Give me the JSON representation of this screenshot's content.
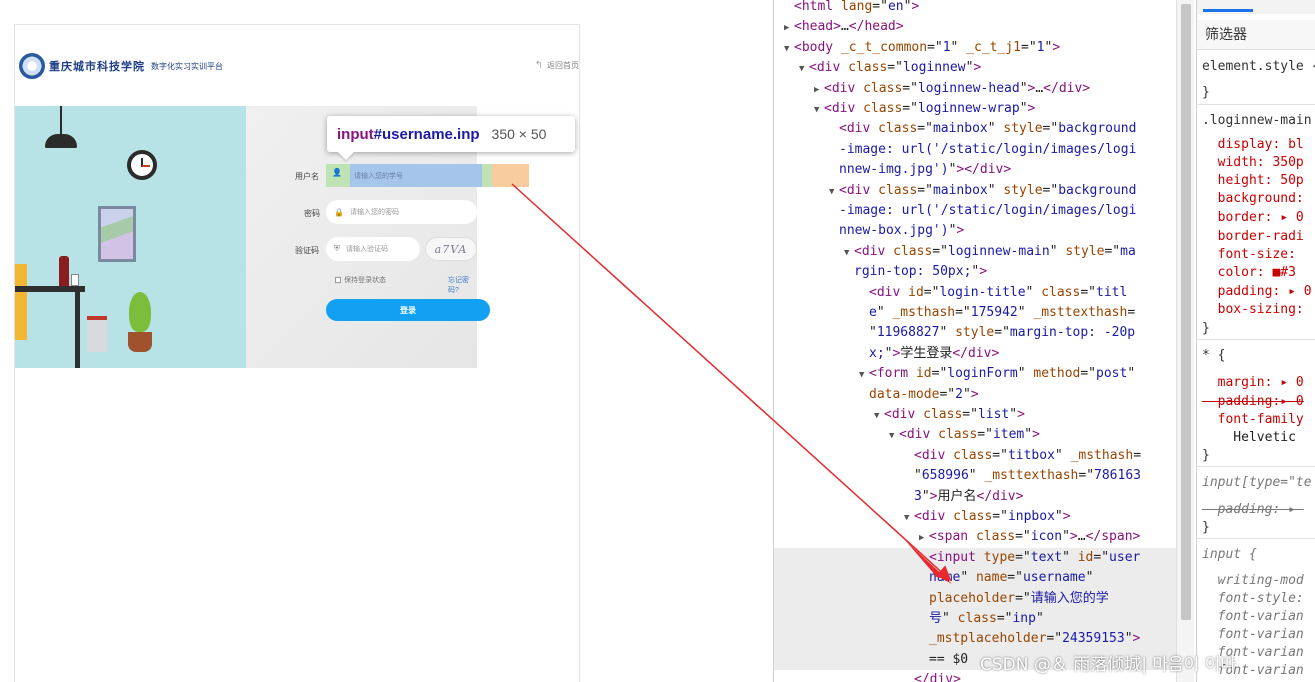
{
  "page": {
    "logo_text": "重庆城市科技学院",
    "platform_name": "数字化实习实训平台",
    "back_link": "返回首页",
    "form": {
      "username_label": "用户名",
      "username_placeholder": "请输入您的学号",
      "password_label": "密码",
      "password_placeholder": "请输入您的密码",
      "captcha_label": "验证码",
      "captcha_placeholder": "请输入验证码",
      "captcha_text": "a7VA",
      "remember": "保持登录状态",
      "forgot": "忘记密码?",
      "submit": "登录"
    }
  },
  "tooltip": {
    "selector_tag": "input",
    "selector_id": "#username.inp",
    "size": "350 × 50"
  },
  "elements": {
    "lines": [
      {
        "indent": 1,
        "tw": "",
        "parts": [
          [
            "t",
            "<html "
          ],
          [
            "a",
            "lang"
          ],
          [
            "x",
            "=\""
          ],
          [
            "v",
            "en"
          ],
          [
            "x",
            "\""
          ],
          [
            "t",
            ">"
          ]
        ]
      },
      {
        "indent": 1,
        "tw": "▶",
        "parts": [
          [
            "t",
            "<head>"
          ],
          [
            "x",
            "…"
          ],
          [
            "t",
            "</head>"
          ]
        ]
      },
      {
        "indent": 1,
        "tw": "▼",
        "parts": [
          [
            "t",
            "<body "
          ],
          [
            "a",
            "_c_t_common"
          ],
          [
            "x",
            "=\""
          ],
          [
            "v",
            "1"
          ],
          [
            "x",
            "\" "
          ],
          [
            "a",
            "_c_t_j1"
          ],
          [
            "x",
            "=\""
          ],
          [
            "v",
            "1"
          ],
          [
            "x",
            "\""
          ],
          [
            "t",
            ">"
          ]
        ]
      },
      {
        "indent": 2,
        "tw": "▼",
        "parts": [
          [
            "t",
            "<div "
          ],
          [
            "a",
            "class"
          ],
          [
            "x",
            "=\""
          ],
          [
            "v",
            "loginnew"
          ],
          [
            "x",
            "\""
          ],
          [
            "t",
            ">"
          ]
        ]
      },
      {
        "indent": 3,
        "tw": "▶",
        "parts": [
          [
            "t",
            "<div "
          ],
          [
            "a",
            "class"
          ],
          [
            "x",
            "=\""
          ],
          [
            "v",
            "loginnew-head"
          ],
          [
            "x",
            "\""
          ],
          [
            "t",
            ">"
          ],
          [
            "x",
            "…"
          ],
          [
            "t",
            "</div>"
          ]
        ]
      },
      {
        "indent": 3,
        "tw": "▼",
        "parts": [
          [
            "t",
            "<div "
          ],
          [
            "a",
            "class"
          ],
          [
            "x",
            "=\""
          ],
          [
            "v",
            "loginnew-wrap"
          ],
          [
            "x",
            "\""
          ],
          [
            "t",
            ">"
          ]
        ]
      },
      {
        "indent": 4,
        "tw": "",
        "parts": [
          [
            "t",
            "<div "
          ],
          [
            "a",
            "class"
          ],
          [
            "x",
            "=\""
          ],
          [
            "v",
            "mainbox"
          ],
          [
            "x",
            "\" "
          ],
          [
            "a",
            "style"
          ],
          [
            "x",
            "=\""
          ],
          [
            "v",
            "background"
          ]
        ]
      },
      {
        "indent": 4,
        "tw": "",
        "parts": [
          [
            "v",
            "-image: url('/static/login/images/logi"
          ]
        ]
      },
      {
        "indent": 4,
        "tw": "",
        "parts": [
          [
            "v",
            "nnew-img.jpg')"
          ],
          [
            "x",
            "\""
          ],
          [
            "t",
            ">"
          ],
          [
            "t",
            "</div>"
          ]
        ]
      },
      {
        "indent": 4,
        "tw": "▼",
        "parts": [
          [
            "t",
            "<div "
          ],
          [
            "a",
            "class"
          ],
          [
            "x",
            "=\""
          ],
          [
            "v",
            "mainbox"
          ],
          [
            "x",
            "\" "
          ],
          [
            "a",
            "style"
          ],
          [
            "x",
            "=\""
          ],
          [
            "v",
            "background"
          ]
        ]
      },
      {
        "indent": 4,
        "tw": "",
        "parts": [
          [
            "v",
            "-image: url('/static/login/images/logi"
          ]
        ]
      },
      {
        "indent": 4,
        "tw": "",
        "parts": [
          [
            "v",
            "nnew-box.jpg')"
          ],
          [
            "x",
            "\""
          ],
          [
            "t",
            ">"
          ]
        ]
      },
      {
        "indent": 5,
        "tw": "▼",
        "parts": [
          [
            "t",
            "<div "
          ],
          [
            "a",
            "class"
          ],
          [
            "x",
            "=\""
          ],
          [
            "v",
            "loginnew-main"
          ],
          [
            "x",
            "\" "
          ],
          [
            "a",
            "style"
          ],
          [
            "x",
            "=\""
          ],
          [
            "v",
            "ma"
          ]
        ]
      },
      {
        "indent": 5,
        "tw": "",
        "parts": [
          [
            "v",
            "rgin-top: 50px;"
          ],
          [
            "x",
            "\""
          ],
          [
            "t",
            ">"
          ]
        ]
      },
      {
        "indent": 6,
        "tw": "",
        "parts": [
          [
            "t",
            "<div "
          ],
          [
            "a",
            "id"
          ],
          [
            "x",
            "=\""
          ],
          [
            "v",
            "login-title"
          ],
          [
            "x",
            "\" "
          ],
          [
            "a",
            "class"
          ],
          [
            "x",
            "=\""
          ],
          [
            "v",
            "titl"
          ]
        ]
      },
      {
        "indent": 6,
        "tw": "",
        "parts": [
          [
            "v",
            "e"
          ],
          [
            "x",
            "\" "
          ],
          [
            "a",
            "_msthash"
          ],
          [
            "x",
            "=\""
          ],
          [
            "v",
            "175942"
          ],
          [
            "x",
            "\" "
          ],
          [
            "a",
            "_msttexthash"
          ],
          [
            "x",
            "="
          ]
        ]
      },
      {
        "indent": 6,
        "tw": "",
        "parts": [
          [
            "x",
            "\""
          ],
          [
            "v",
            "11968827"
          ],
          [
            "x",
            "\" "
          ],
          [
            "a",
            "style"
          ],
          [
            "x",
            "=\""
          ],
          [
            "v",
            "margin-top: -20p"
          ]
        ]
      },
      {
        "indent": 6,
        "tw": "",
        "parts": [
          [
            "v",
            "x;"
          ],
          [
            "x",
            "\""
          ],
          [
            "t",
            ">"
          ],
          [
            "x",
            "学生登录"
          ],
          [
            "t",
            "</div>"
          ]
        ]
      },
      {
        "indent": 6,
        "tw": "▼",
        "parts": [
          [
            "t",
            "<form "
          ],
          [
            "a",
            "id"
          ],
          [
            "x",
            "=\""
          ],
          [
            "v",
            "loginForm"
          ],
          [
            "x",
            "\" "
          ],
          [
            "a",
            "method"
          ],
          [
            "x",
            "=\""
          ],
          [
            "v",
            "post"
          ],
          [
            "x",
            "\""
          ]
        ]
      },
      {
        "indent": 6,
        "tw": "",
        "parts": [
          [
            "a",
            "data-mode"
          ],
          [
            "x",
            "=\""
          ],
          [
            "v",
            "2"
          ],
          [
            "x",
            "\""
          ],
          [
            "t",
            ">"
          ]
        ]
      },
      {
        "indent": 7,
        "tw": "▼",
        "parts": [
          [
            "t",
            "<div "
          ],
          [
            "a",
            "class"
          ],
          [
            "x",
            "=\""
          ],
          [
            "v",
            "list"
          ],
          [
            "x",
            "\""
          ],
          [
            "t",
            ">"
          ]
        ]
      },
      {
        "indent": 8,
        "tw": "▼",
        "parts": [
          [
            "t",
            "<div "
          ],
          [
            "a",
            "class"
          ],
          [
            "x",
            "=\""
          ],
          [
            "v",
            "item"
          ],
          [
            "x",
            "\""
          ],
          [
            "t",
            ">"
          ]
        ]
      },
      {
        "indent": 9,
        "tw": "",
        "parts": [
          [
            "t",
            "<div "
          ],
          [
            "a",
            "class"
          ],
          [
            "x",
            "=\""
          ],
          [
            "v",
            "titbox"
          ],
          [
            "x",
            "\" "
          ],
          [
            "a",
            "_msthash"
          ],
          [
            "x",
            "="
          ]
        ]
      },
      {
        "indent": 9,
        "tw": "",
        "parts": [
          [
            "x",
            "\""
          ],
          [
            "v",
            "658996"
          ],
          [
            "x",
            "\" "
          ],
          [
            "a",
            "_msttexthash"
          ],
          [
            "x",
            "=\""
          ],
          [
            "v",
            "786163"
          ]
        ]
      },
      {
        "indent": 9,
        "tw": "",
        "parts": [
          [
            "v",
            "3"
          ],
          [
            "x",
            "\""
          ],
          [
            "t",
            ">"
          ],
          [
            "x",
            "用户名"
          ],
          [
            "t",
            "</div>"
          ]
        ]
      },
      {
        "indent": 9,
        "tw": "▼",
        "parts": [
          [
            "t",
            "<div "
          ],
          [
            "a",
            "class"
          ],
          [
            "x",
            "=\""
          ],
          [
            "v",
            "inpbox"
          ],
          [
            "x",
            "\""
          ],
          [
            "t",
            ">"
          ]
        ]
      },
      {
        "indent": 10,
        "tw": "▶",
        "parts": [
          [
            "t",
            "<span "
          ],
          [
            "a",
            "class"
          ],
          [
            "x",
            "=\""
          ],
          [
            "v",
            "icon"
          ],
          [
            "x",
            "\""
          ],
          [
            "t",
            ">"
          ],
          [
            "x",
            "…"
          ],
          [
            "t",
            "</span>"
          ]
        ]
      },
      {
        "indent": 10,
        "tw": "",
        "sel": true,
        "parts": [
          [
            "t",
            "<input "
          ],
          [
            "a",
            "type"
          ],
          [
            "x",
            "=\""
          ],
          [
            "v",
            "text"
          ],
          [
            "x",
            "\" "
          ],
          [
            "a",
            "id"
          ],
          [
            "x",
            "=\""
          ],
          [
            "v",
            "user"
          ]
        ]
      },
      {
        "indent": 10,
        "tw": "",
        "sel": true,
        "parts": [
          [
            "v",
            "name"
          ],
          [
            "x",
            "\" "
          ],
          [
            "a",
            "name"
          ],
          [
            "x",
            "=\""
          ],
          [
            "v",
            "username"
          ],
          [
            "x",
            "\""
          ]
        ]
      },
      {
        "indent": 10,
        "tw": "",
        "sel": true,
        "parts": [
          [
            "a",
            "placeholder"
          ],
          [
            "x",
            "=\""
          ],
          [
            "v",
            "请输入您的学"
          ]
        ]
      },
      {
        "indent": 10,
        "tw": "",
        "sel": true,
        "parts": [
          [
            "v",
            "号"
          ],
          [
            "x",
            "\" "
          ],
          [
            "a",
            "class"
          ],
          [
            "x",
            "=\""
          ],
          [
            "v",
            "inp"
          ],
          [
            "x",
            "\""
          ]
        ]
      },
      {
        "indent": 10,
        "tw": "",
        "sel": true,
        "parts": [
          [
            "a",
            "_mstplaceholder"
          ],
          [
            "x",
            "=\""
          ],
          [
            "v",
            "24359153"
          ],
          [
            "x",
            "\""
          ],
          [
            "t",
            ">"
          ]
        ]
      },
      {
        "indent": 10,
        "tw": "",
        "sel": true,
        "parts": [
          [
            "x",
            "== $0"
          ]
        ]
      },
      {
        "indent": 9,
        "tw": "",
        "parts": [
          [
            "t",
            "</div>"
          ]
        ]
      }
    ]
  },
  "styles": {
    "filter": "筛选器",
    "lines": [
      {
        "cls": "sel-c",
        "text": "element.style {"
      },
      {
        "cls": "sel-c",
        "text": "}"
      },
      {
        "cls": "sel-c",
        "text": ".loginnew-main"
      },
      {
        "cls": "prop",
        "text": "  display: bl"
      },
      {
        "cls": "prop",
        "text": "  width: 350p"
      },
      {
        "cls": "prop",
        "text": "  height: 50p"
      },
      {
        "cls": "prop",
        "text": "  background:"
      },
      {
        "cls": "prop",
        "text": "  border: ▸ 0"
      },
      {
        "cls": "prop",
        "text": "  border-radi"
      },
      {
        "cls": "prop",
        "text": "  font-size:"
      },
      {
        "cls": "prop",
        "text": "  color: ■#3"
      },
      {
        "cls": "prop",
        "text": "  padding: ▸ 0"
      },
      {
        "cls": "prop",
        "text": "  box-sizing:"
      },
      {
        "cls": "sel-c",
        "text": "}"
      },
      {
        "cls": "sel-c",
        "text": "* {"
      },
      {
        "cls": "prop",
        "text": "  margin: ▸ 0"
      },
      {
        "cls": "prop strike",
        "text": "  padding:▸ 0"
      },
      {
        "cls": "prop",
        "text": "  font-family"
      },
      {
        "cls": "val-c",
        "text": "    Helvetic"
      },
      {
        "cls": "sel-c",
        "text": "}"
      },
      {
        "cls": "ital",
        "text": "input[type=\"te"
      },
      {
        "cls": "ital strike",
        "text": "  padding: ▸ "
      },
      {
        "cls": "sel-c",
        "text": "}"
      },
      {
        "cls": "ital",
        "text": "input {"
      },
      {
        "cls": "ital",
        "text": "  writing-mod"
      },
      {
        "cls": "ital",
        "text": "  font-style:"
      },
      {
        "cls": "ital",
        "text": "  font-varian"
      },
      {
        "cls": "ital",
        "text": "  font-varian"
      },
      {
        "cls": "ital",
        "text": "  font-varian"
      },
      {
        "cls": "ital",
        "text": "  font-varian"
      }
    ]
  },
  "watermark": "CSDN @＆  雨落倾城|  마음이 이따"
}
